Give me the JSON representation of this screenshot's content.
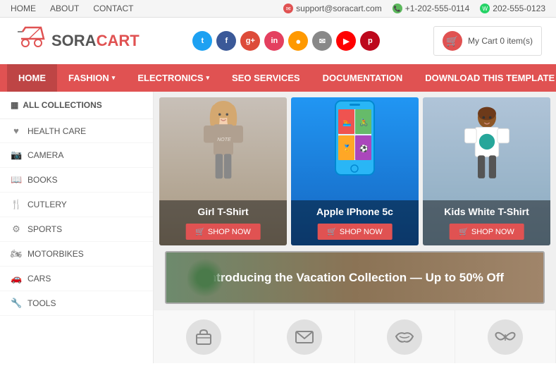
{
  "topbar": {
    "links": [
      "HOME",
      "ABOUT",
      "CONTACT"
    ],
    "support_email": "support@soracart.com",
    "phone": "+1-202-555-0114",
    "whatsapp": "202-555-0123"
  },
  "logo": {
    "text_sora": "SORA",
    "text_cart": "CART"
  },
  "social": {
    "buttons": [
      "t",
      "f",
      "g+",
      "in",
      "rss",
      "✉",
      "▶",
      "p"
    ]
  },
  "cart": {
    "label": "My Cart 0 item(s)"
  },
  "nav": {
    "items": [
      {
        "label": "HOME",
        "active": true
      },
      {
        "label": "FASHION",
        "has_dropdown": true
      },
      {
        "label": "ELECTRONICS",
        "has_dropdown": true
      },
      {
        "label": "SEO SERVICES"
      },
      {
        "label": "DOCUMENTATION"
      },
      {
        "label": "DOWNLOAD THIS TEMPLATE"
      }
    ]
  },
  "sidebar": {
    "header": "ALL COLLECTIONS",
    "items": [
      {
        "label": "HEALTH CARE",
        "icon": "♥"
      },
      {
        "label": "CAMERA",
        "icon": "📷"
      },
      {
        "label": "BOOKS",
        "icon": "📖"
      },
      {
        "label": "CUTLERY",
        "icon": "🍴"
      },
      {
        "label": "SPORTS",
        "icon": "⚙"
      },
      {
        "label": "MOTORBIKES",
        "icon": "🏍"
      },
      {
        "label": "CARS",
        "icon": "🚗"
      },
      {
        "label": "TOOLS",
        "icon": "🔧"
      }
    ]
  },
  "banners": [
    {
      "title": "Girl T-Shirt",
      "shop_label": "SHOP NOW"
    },
    {
      "title": "Apple IPhone 5c",
      "shop_label": "SHOP NOW"
    },
    {
      "title": "Kids White T-Shirt",
      "shop_label": "SHOP NOW"
    }
  ],
  "vacation": {
    "text": "Introducing the Vacation Collection — Up to 50% Off"
  },
  "bottom_icons": [
    {
      "icon": "👜"
    },
    {
      "icon": "✉"
    },
    {
      "icon": "👄"
    },
    {
      "icon": "🦋"
    }
  ]
}
